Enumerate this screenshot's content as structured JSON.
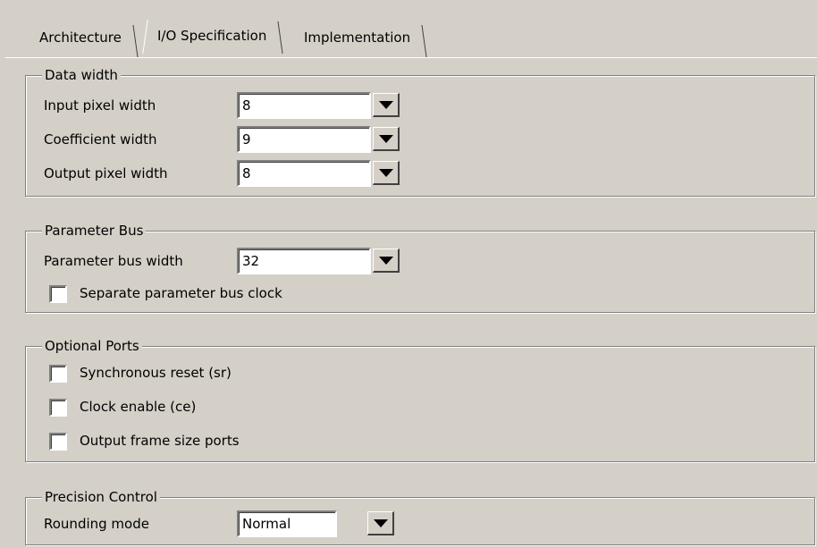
{
  "tabs": [
    {
      "label": "Architecture",
      "active": false
    },
    {
      "label": "I/O Specification",
      "active": true
    },
    {
      "label": "Implementation",
      "active": false
    }
  ],
  "data_width": {
    "title": "Data width",
    "rows": [
      {
        "label": "Input pixel width",
        "value": "8"
      },
      {
        "label": "Coefficient width",
        "value": "9"
      },
      {
        "label": "Output pixel width",
        "value": "8"
      }
    ]
  },
  "parameter_bus": {
    "title": "Parameter Bus",
    "width_label": "Parameter bus width",
    "width_value": "32",
    "separate_clock_label": "Separate parameter bus clock",
    "separate_clock_checked": false
  },
  "optional_ports": {
    "title": "Optional Ports",
    "items": [
      {
        "label": "Synchronous reset (sr)",
        "checked": false
      },
      {
        "label": "Clock enable (ce)",
        "checked": false
      },
      {
        "label": "Output frame size ports",
        "checked": false
      }
    ]
  },
  "precision_control": {
    "title": "Precision Control",
    "rounding_label": "Rounding mode",
    "rounding_value": "Normal"
  },
  "colors": {
    "face": "#d4d0c8",
    "shadow": "#808080",
    "highlight": "#ffffff",
    "dark_shadow": "#404040"
  }
}
